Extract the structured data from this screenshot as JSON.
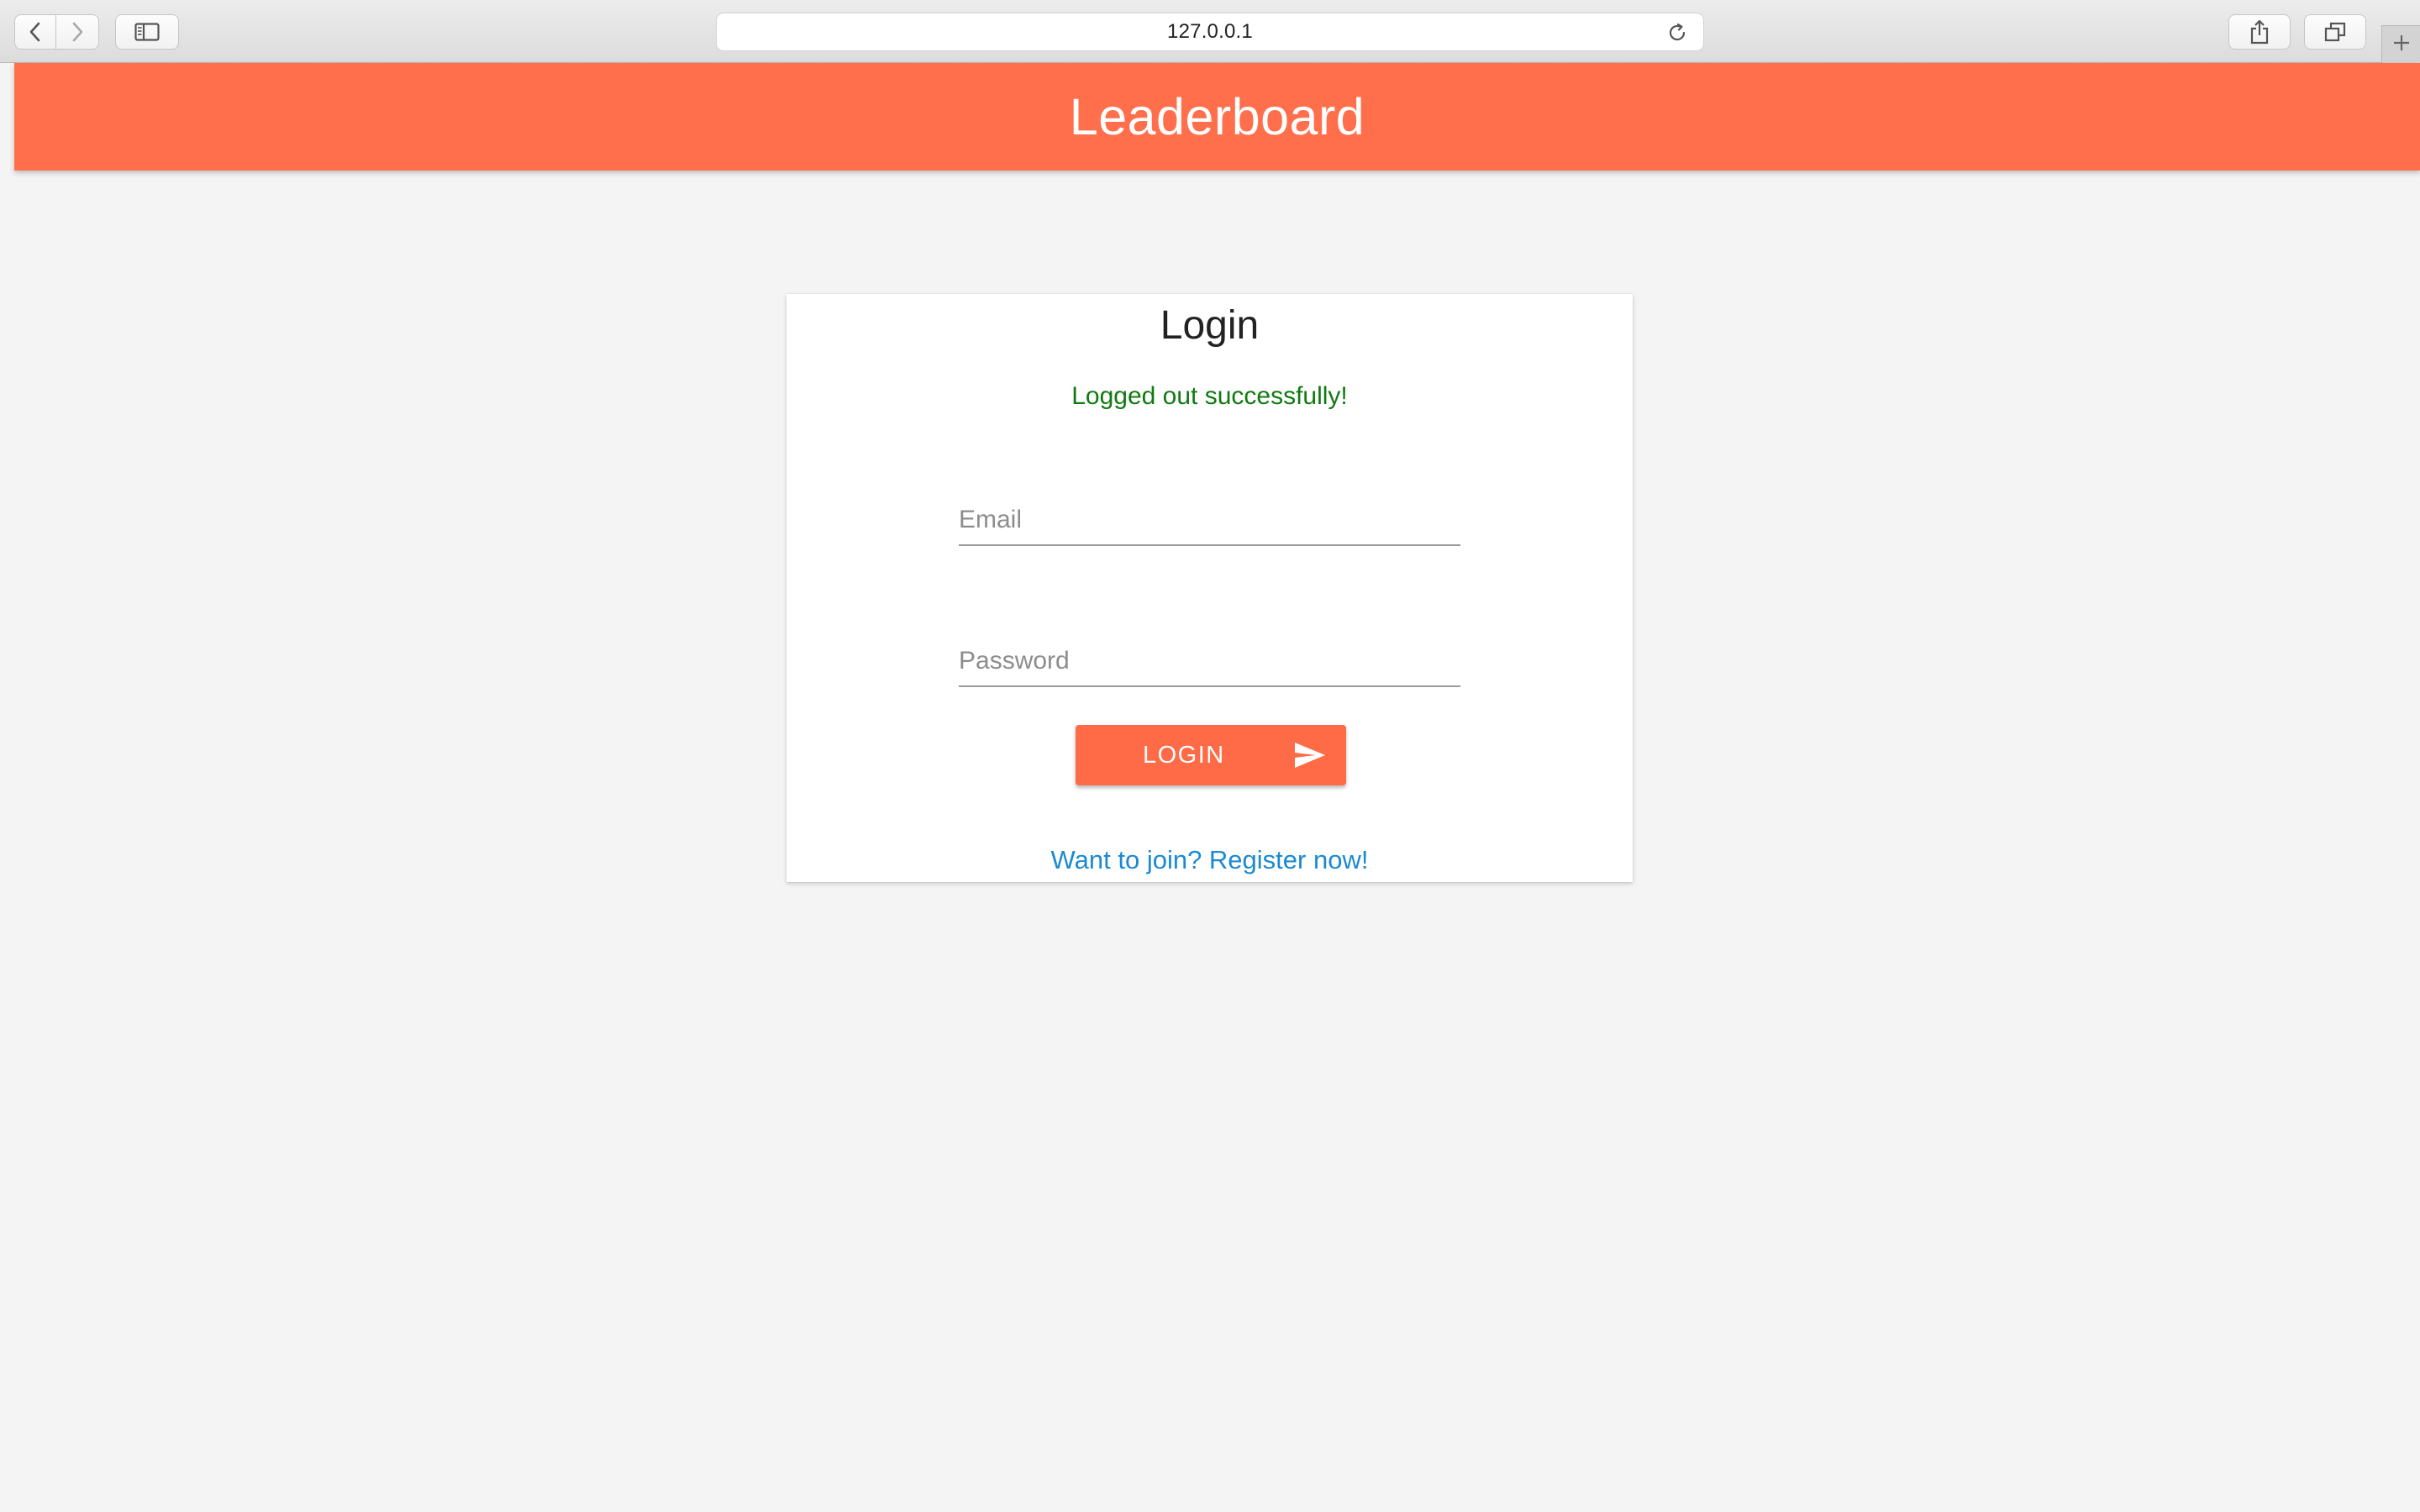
{
  "browser": {
    "url": "127.0.0.1",
    "buttons": {
      "back": "chevron-left-icon",
      "forward": "chevron-right-icon",
      "sidebar": "sidebar-icon",
      "reload": "reload-icon",
      "share": "share-icon",
      "tabs": "tabs-icon",
      "new_tab": "plus-icon"
    }
  },
  "header": {
    "title": "Leaderboard",
    "color": "#ff6f4c"
  },
  "login": {
    "title": "Login",
    "flash_message": "Logged out successfully!",
    "flash_color": "#107a10",
    "email_placeholder": "Email",
    "password_placeholder": "Password",
    "button_label": "LOGIN",
    "button_icon": "send-icon",
    "register_link": "Want to join? Register now!",
    "link_color": "#1a8ad0"
  }
}
